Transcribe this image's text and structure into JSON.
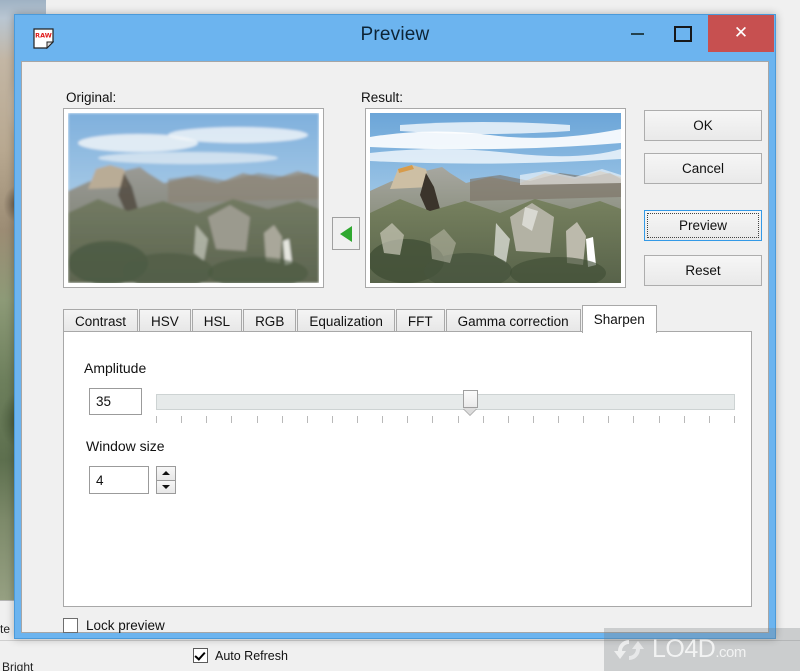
{
  "window": {
    "title": "Preview",
    "app_icon": "raw-document-icon",
    "controls": {
      "minimize": "minimize-icon",
      "maximize": "maximize-icon",
      "close": "close-icon"
    },
    "accent_titlebar_color": "#6cb4ef",
    "close_button_color": "#c75050"
  },
  "panes": {
    "original_label": "Original:",
    "result_label": "Result:",
    "swap_icon": "left-triangle-icon",
    "swap_icon_color": "#2fa82f",
    "image_subject": "Yosemite Valley with Half Dome"
  },
  "buttons": {
    "ok": "OK",
    "cancel": "Cancel",
    "preview": "Preview",
    "reset": "Reset"
  },
  "tabs": [
    {
      "label": "Contrast",
      "active": false
    },
    {
      "label": "HSV",
      "active": false
    },
    {
      "label": "HSL",
      "active": false
    },
    {
      "label": "RGB",
      "active": false
    },
    {
      "label": "Equalization",
      "active": false
    },
    {
      "label": "FFT",
      "active": false
    },
    {
      "label": "Gamma correction",
      "active": false
    },
    {
      "label": "Sharpen",
      "active": true
    }
  ],
  "sharpen": {
    "amplitude_label": "Amplitude",
    "amplitude_value": "35",
    "window_size_label": "Window size",
    "window_size_value": "4",
    "spinner_up_icon": "caret-up-icon",
    "spinner_down_icon": "caret-down-icon",
    "slider_tick_count": 24
  },
  "footer": {
    "lock_preview_label": "Lock preview",
    "lock_preview_checked": false
  },
  "background": {
    "auto_refresh_label": "Auto Refresh",
    "auto_refresh_checked": true,
    "left_text_1": "te",
    "left_text_2": "Bright"
  },
  "watermark": {
    "text": "LO4D",
    "suffix": ".com",
    "icon": "refresh-circle-arrows-icon"
  }
}
